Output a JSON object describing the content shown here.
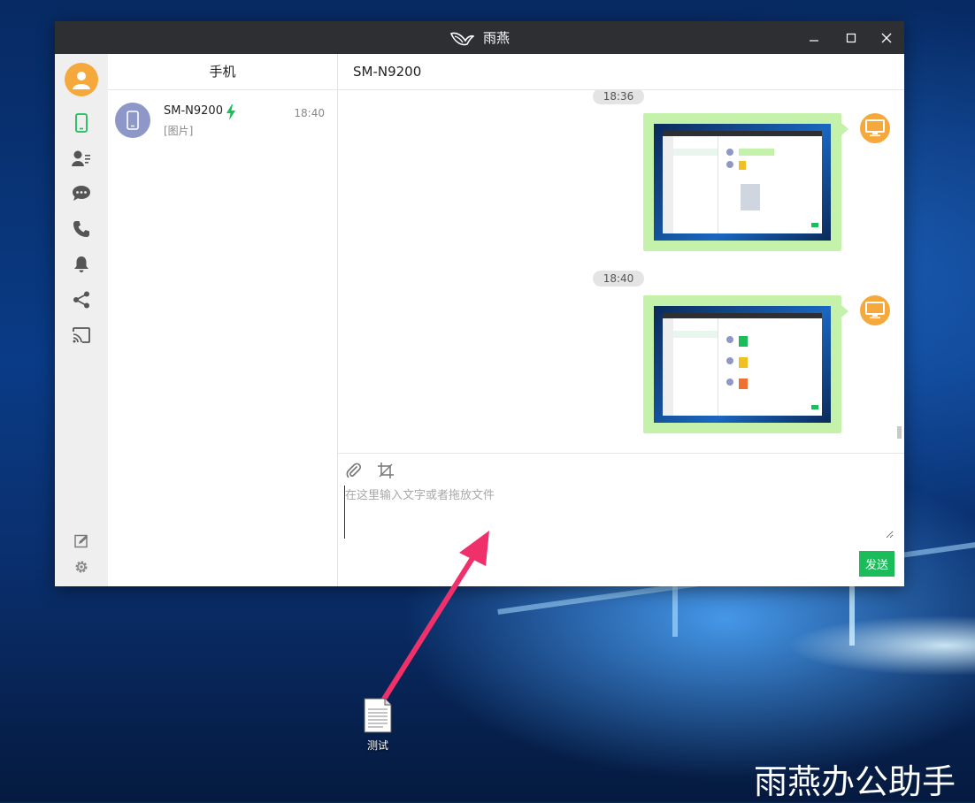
{
  "window": {
    "title": "雨燕",
    "colors": {
      "titlebar": "#2d2f33",
      "accent": "#1bbd5b",
      "avatar": "#f5a83b",
      "bubble": "#c4f2aa"
    }
  },
  "sidebar": {
    "items": [
      {
        "icon": "phone-icon",
        "active": true
      },
      {
        "icon": "contacts-icon"
      },
      {
        "icon": "message-icon"
      },
      {
        "icon": "call-icon"
      },
      {
        "icon": "notification-bell-icon"
      },
      {
        "icon": "share-icon"
      },
      {
        "icon": "cast-icon"
      }
    ],
    "bottom": [
      {
        "icon": "edit-icon"
      },
      {
        "icon": "settings-gear-icon"
      }
    ]
  },
  "contacts": {
    "header": "手机",
    "items": [
      {
        "name": "SM-N9200",
        "preview": "[图片]",
        "time": "18:40",
        "charging": true
      }
    ]
  },
  "chat": {
    "title": "SM-N9200",
    "messages": [
      {
        "time": "18:36",
        "type": "image",
        "sender": "computer"
      },
      {
        "time": "18:40",
        "type": "image",
        "sender": "computer"
      }
    ],
    "input": {
      "placeholder": "在这里输入文字或者拖放文件",
      "value": ""
    },
    "send_label": "发送"
  },
  "desktop": {
    "icon_label": "测试",
    "watermark": "雨燕办公助手"
  }
}
